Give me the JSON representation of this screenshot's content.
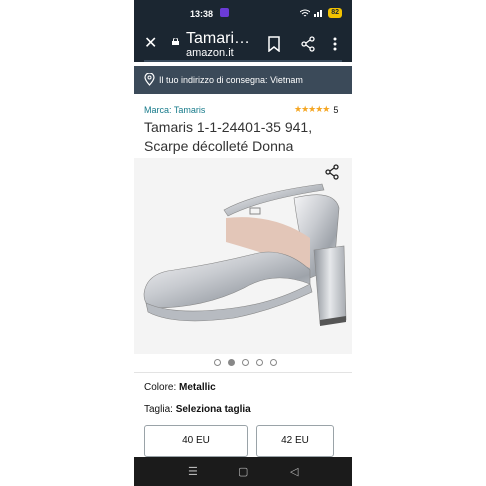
{
  "status_bar": {
    "time": "13:38",
    "battery": "82"
  },
  "app_bar": {
    "title": "Tamari…",
    "domain": "amazon.it"
  },
  "delivery": {
    "text": "Il tuo indirizzo di consegna: Vietnam"
  },
  "product": {
    "brand": "Marca: Tamaris",
    "rating_stars": "★★★★★",
    "rating_value": 4.5,
    "review_count": "5",
    "title": "Tamaris 1-1-24401-35 941, Scarpe décolleté Donna",
    "image_pages": 5,
    "current_image": 2
  },
  "options": {
    "color_label": "Colore:",
    "color_value": "Metallic",
    "size_label": "Taglia:",
    "size_value": "Seleziona taglia",
    "sizes": [
      "40 EU",
      "42 EU"
    ]
  },
  "nav": {
    "menu": "☰",
    "home": "▢",
    "back": "◁"
  },
  "colors": {
    "header": "#1b2631",
    "delivery": "#3b4a59",
    "link": "#167a8a",
    "star": "#f5a623"
  }
}
